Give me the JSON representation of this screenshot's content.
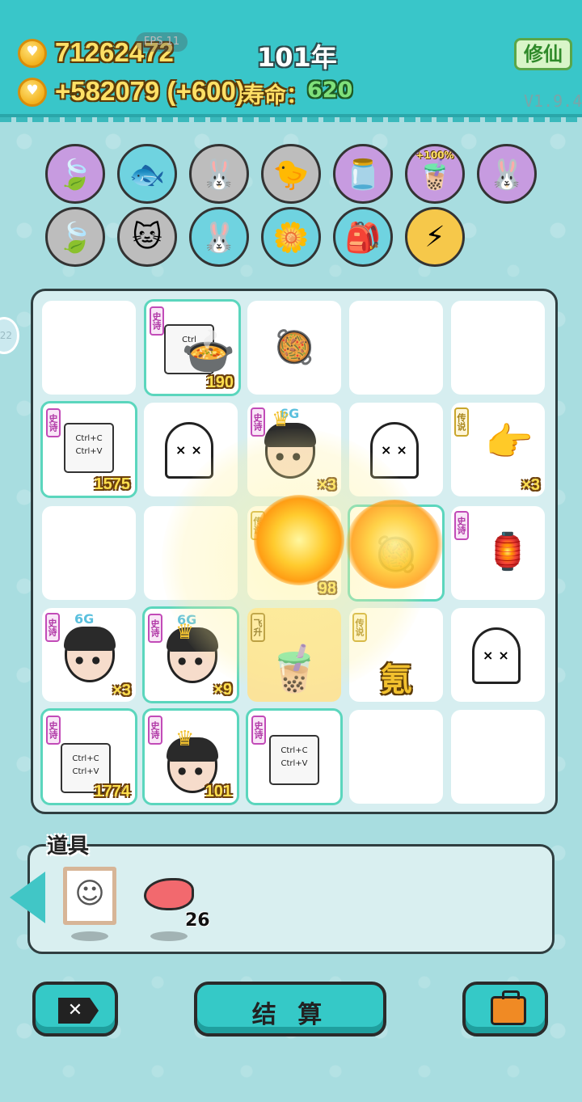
{
  "header": {
    "coins": "71262472",
    "income": "+582079 (+600)",
    "fps": "FPS 11",
    "year": "101年",
    "life_label": "寿命：",
    "life_value": "620",
    "cultivate_button": "修仙",
    "version": "V1.9.4"
  },
  "buffs": [
    {
      "icon": "leaf-icon",
      "bg": "#c79be0",
      "glyph": "🍃"
    },
    {
      "icon": "fishbowl-icon",
      "bg": "#6fd3e0",
      "glyph": "🐟"
    },
    {
      "icon": "rabbit-icon",
      "bg": "#bdbdbd",
      "glyph": "🐰"
    },
    {
      "icon": "chick-icon",
      "bg": "#bdbdbd",
      "glyph": "🐤"
    },
    {
      "icon": "jar-icon",
      "bg": "#c79be0",
      "glyph": "🫙"
    },
    {
      "icon": "milk-tea-icon",
      "bg": "#c79be0",
      "glyph": "🧋",
      "label": "+100%"
    },
    {
      "icon": "rabbit-icon",
      "bg": "#c79be0",
      "glyph": "🐰"
    },
    {
      "icon": "leaf-icon",
      "bg": "#bdbdbd",
      "glyph": "🍃"
    },
    {
      "icon": "cat-icon",
      "bg": "#bdbdbd",
      "glyph": "🐱"
    },
    {
      "icon": "rabbit-icon",
      "bg": "#6fd3e0",
      "glyph": "🐰"
    },
    {
      "icon": "flower-pot-icon",
      "bg": "#6fd3e0",
      "glyph": "🌼"
    },
    {
      "icon": "bag-icon",
      "bg": "#6fd3e0",
      "glyph": "🎒"
    },
    {
      "icon": "lightning-icon",
      "bg": "#f6c84a",
      "glyph": "⚡"
    }
  ],
  "board": {
    "tags": {
      "epic": "史诗",
      "legend": "传说",
      "ascend": "飞升"
    },
    "ctrl_text": "Ctrl+C Ctrl+V",
    "g6": "6G",
    "cells": {
      "r1c2_count": "190",
      "r2c1_count": "1575",
      "r2c3_count": "×3",
      "r2c5_count": "×3",
      "r3c3_count": "98",
      "r4c1_count": "×3",
      "r4c2_count": "×9",
      "r4c4_char": "氪",
      "r5c1_count": "1774",
      "r5c2_count": "101"
    }
  },
  "items": {
    "label": "道具",
    "liver_count": "26"
  },
  "buttons": {
    "settle": "结 算"
  }
}
